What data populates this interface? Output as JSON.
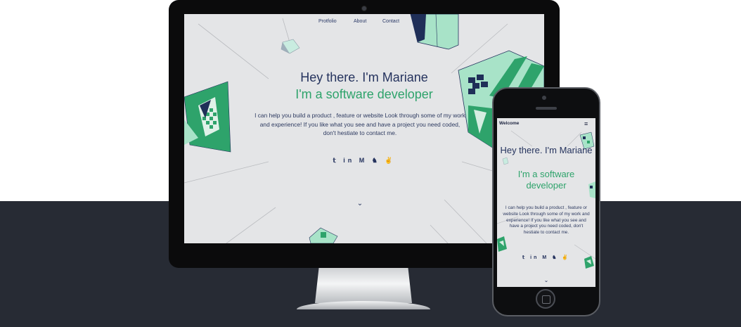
{
  "desktop": {
    "nav": [
      "Protfolio",
      "About",
      "Contact"
    ],
    "hero": {
      "title": "Hey there. I'm Mariane",
      "subtitle": "I'm a software developer",
      "description": "I can help you build a product , feature or website Look through some of my work and experience! If you like what you see and have a project you need coded, don't hestiate to contact me."
    },
    "social_icons": [
      "twitter-icon",
      "linkedin-icon",
      "medium-icon",
      "github-icon",
      "angellist-icon"
    ],
    "social_glyphs": "𝕥 in M ♞ ✌",
    "scroll_glyph": "⌄"
  },
  "mobile": {
    "header_title": "Welcome",
    "menu_glyph": "≡",
    "hero": {
      "title": "Hey there. I'm Mariane",
      "subtitle": "I'm a software developer",
      "description": "I can help you build a product , feature or website Look through some of my work and experience! If you like what you see and have a project you need coded, don't hestiate to contact me."
    },
    "social_glyphs": "𝕥 in M ♞ ✌",
    "scroll_glyph": "⌄"
  },
  "colors": {
    "navy": "#25335e",
    "green": "#2ea36b",
    "mint": "#a8e3c8",
    "screen_bg": "#e4e5e7",
    "band": "#272b34"
  }
}
